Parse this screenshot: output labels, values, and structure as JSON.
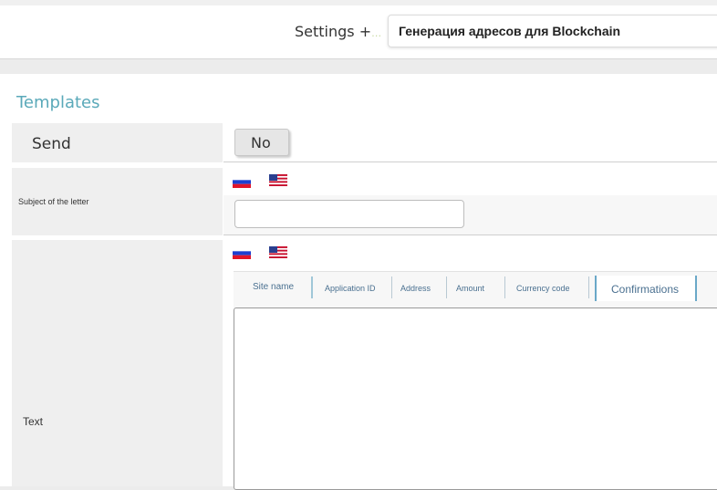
{
  "header": {
    "breadcrumb_text": "Settings +",
    "breadcrumb_fade": "…",
    "page_title": "Генерация адресов для Blockchain"
  },
  "section": {
    "title": "Templates"
  },
  "send": {
    "label": "Send",
    "toggle_value": "No"
  },
  "subject": {
    "label": "Subject of the letter",
    "value": ""
  },
  "languages": [
    "ru-flag-icon",
    "us-flag-icon"
  ],
  "text": {
    "label": "Text",
    "tags": [
      "Site name",
      "Application ID",
      "Address",
      "Amount",
      "Currency code",
      "Confirmations"
    ],
    "value": ""
  }
}
